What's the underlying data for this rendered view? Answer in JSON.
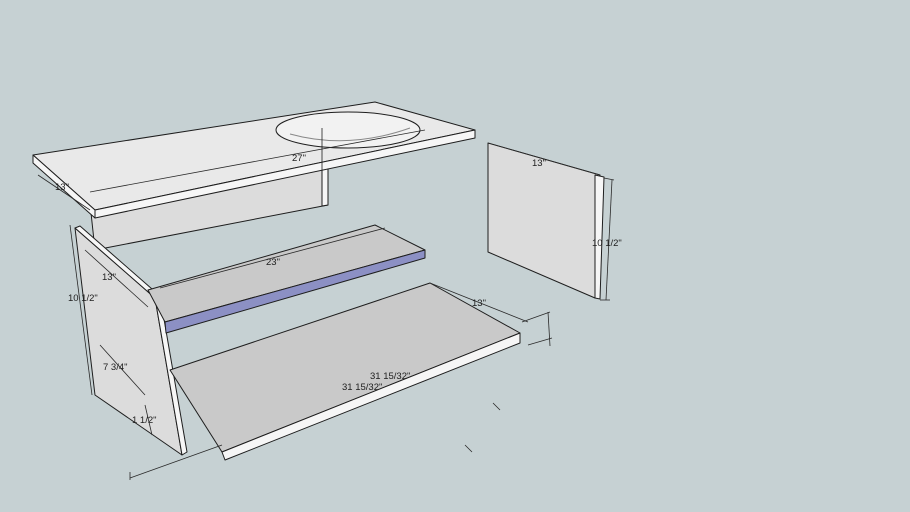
{
  "dimensions": {
    "top_width": "27\"",
    "top_depth": "13\"",
    "side_depth": "13\"",
    "side_height": "10 1/2\"",
    "kick_height": "7 3/4\"",
    "kick_inset": "1 1/2\"",
    "shelf_width": "23\"",
    "bottom_depth": "13\"",
    "bottom_length_1": "31 15/32\"",
    "bottom_length_2": "31 15/32\"",
    "back_width": "13\"",
    "back_height": "10 1/2\""
  },
  "colors": {
    "background": "#c6d1d3",
    "shelf_front_edge": "#8c90c4"
  }
}
